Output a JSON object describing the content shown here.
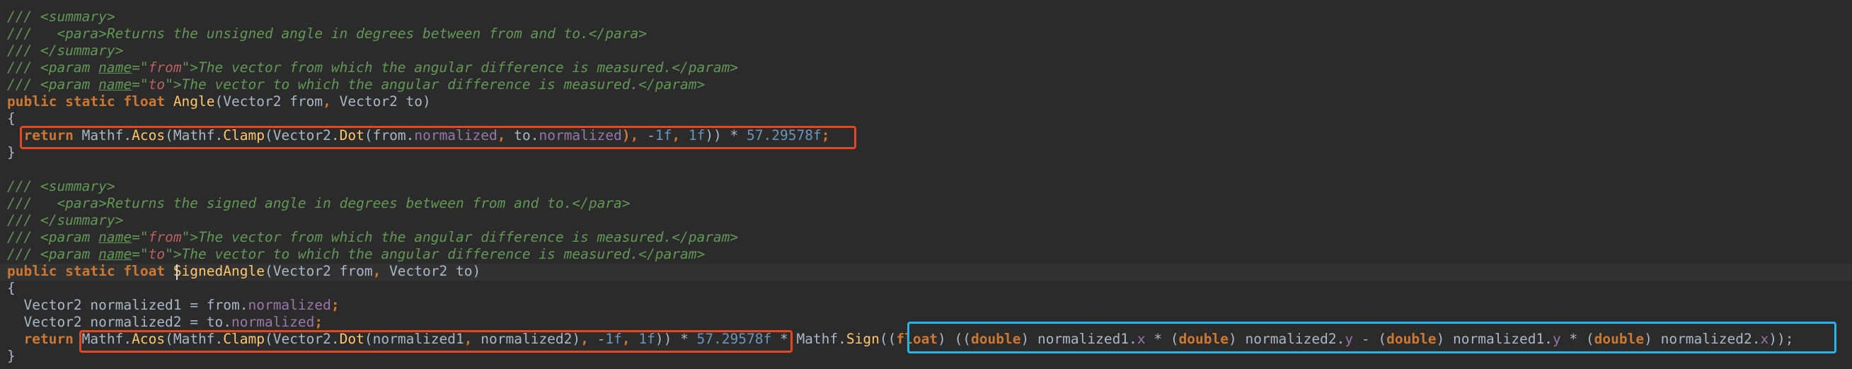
{
  "code": {
    "lines": [
      [
        {
          "t": "/// <summary>",
          "c": "c"
        }
      ],
      [
        {
          "t": "///   <para>",
          "c": "c"
        },
        {
          "t": "Returns the unsigned angle in degrees between from and to.",
          "c": "c"
        },
        {
          "t": "</para>",
          "c": "c"
        }
      ],
      [
        {
          "t": "/// </summary>",
          "c": "c"
        }
      ],
      [
        {
          "t": "/// <param ",
          "c": "c"
        },
        {
          "t": "name",
          "c": "cn"
        },
        {
          "t": "=\"",
          "c": "c"
        },
        {
          "t": "from",
          "c": "cv"
        },
        {
          "t": "\">The vector from which the angular difference is measured.</param>",
          "c": "c"
        }
      ],
      [
        {
          "t": "/// <param ",
          "c": "c"
        },
        {
          "t": "name",
          "c": "cn"
        },
        {
          "t": "=\"",
          "c": "c"
        },
        {
          "t": "to",
          "c": "cv"
        },
        {
          "t": "\">The vector to which the angular difference is measured.</param>",
          "c": "c"
        }
      ],
      [
        {
          "t": "public static float ",
          "c": "kw"
        },
        {
          "t": "Angle",
          "c": "fn"
        },
        {
          "t": "(Vector2 from",
          "c": "id"
        },
        {
          "t": ", ",
          "c": "kw"
        },
        {
          "t": "Vector2 to)",
          "c": "id"
        }
      ],
      [
        {
          "t": "{",
          "c": "id"
        }
      ],
      [
        {
          "t": "  ",
          "c": "id"
        },
        {
          "t": "return ",
          "c": "kw"
        },
        {
          "t": "Mathf.",
          "c": "id"
        },
        {
          "t": "Acos",
          "c": "fn"
        },
        {
          "t": "(Mathf.",
          "c": "id"
        },
        {
          "t": "Clamp",
          "c": "fn"
        },
        {
          "t": "(Vector2.",
          "c": "id"
        },
        {
          "t": "Dot",
          "c": "fn"
        },
        {
          "t": "(from.",
          "c": "id"
        },
        {
          "t": "normalized",
          "c": "pr"
        },
        {
          "t": ", ",
          "c": "kw"
        },
        {
          "t": "to.",
          "c": "id"
        },
        {
          "t": "normalized",
          "c": "pr"
        },
        {
          "t": "), ",
          "c": "kw"
        },
        {
          "t": "-",
          "c": "id"
        },
        {
          "t": "1f",
          "c": "num"
        },
        {
          "t": ", ",
          "c": "kw"
        },
        {
          "t": "1f",
          "c": "num"
        },
        {
          "t": ")) * ",
          "c": "id"
        },
        {
          "t": "57.29578f",
          "c": "num"
        },
        {
          "t": ";",
          "c": "kw"
        }
      ],
      [
        {
          "t": "}",
          "c": "id"
        }
      ],
      [],
      [
        {
          "t": "/// <summary>",
          "c": "c"
        }
      ],
      [
        {
          "t": "///   <para>",
          "c": "c"
        },
        {
          "t": "Returns the signed angle in degrees between from and to.",
          "c": "c"
        },
        {
          "t": "</para>",
          "c": "c"
        }
      ],
      [
        {
          "t": "/// </summary>",
          "c": "c"
        }
      ],
      [
        {
          "t": "/// <param ",
          "c": "c"
        },
        {
          "t": "name",
          "c": "cn"
        },
        {
          "t": "=\"",
          "c": "c"
        },
        {
          "t": "from",
          "c": "cv"
        },
        {
          "t": "\">The vector from which the angular difference is measured.</param>",
          "c": "c"
        }
      ],
      [
        {
          "t": "/// <param ",
          "c": "c"
        },
        {
          "t": "name",
          "c": "cn"
        },
        {
          "t": "=\"",
          "c": "c"
        },
        {
          "t": "to",
          "c": "cv"
        },
        {
          "t": "\">The vector to which the angular difference is measured.</param>",
          "c": "c"
        }
      ],
      [
        {
          "t": "public static float ",
          "c": "kw"
        },
        {
          "t": "SignedAngle",
          "c": "fn"
        },
        {
          "t": "(Vector2 from",
          "c": "id"
        },
        {
          "t": ", ",
          "c": "kw"
        },
        {
          "t": "Vector2 to)",
          "c": "id"
        }
      ],
      [
        {
          "t": "{",
          "c": "id"
        }
      ],
      [
        {
          "t": "  Vector2 normalized1 = from.",
          "c": "id"
        },
        {
          "t": "normalized",
          "c": "pr"
        },
        {
          "t": ";",
          "c": "kw"
        }
      ],
      [
        {
          "t": "  Vector2 normalized2 = to.",
          "c": "id"
        },
        {
          "t": "normalized",
          "c": "pr"
        },
        {
          "t": ";",
          "c": "kw"
        }
      ],
      [
        {
          "t": "  ",
          "c": "id"
        },
        {
          "t": "return ",
          "c": "kw"
        },
        {
          "t": "Mathf.",
          "c": "id"
        },
        {
          "t": "Acos",
          "c": "fn"
        },
        {
          "t": "(Mathf.",
          "c": "id"
        },
        {
          "t": "Clamp",
          "c": "fn"
        },
        {
          "t": "(Vector2.",
          "c": "id"
        },
        {
          "t": "Dot",
          "c": "fn"
        },
        {
          "t": "(normalized1",
          "c": "id"
        },
        {
          "t": ", ",
          "c": "kw"
        },
        {
          "t": "normalized2)",
          "c": "id"
        },
        {
          "t": ", ",
          "c": "kw"
        },
        {
          "t": "-",
          "c": "id"
        },
        {
          "t": "1f",
          "c": "num"
        },
        {
          "t": ", ",
          "c": "kw"
        },
        {
          "t": "1f",
          "c": "num"
        },
        {
          "t": ")) * ",
          "c": "id"
        },
        {
          "t": "57.29578f",
          "c": "num"
        },
        {
          "t": " * Mathf.",
          "c": "id"
        },
        {
          "t": "Sign",
          "c": "fn"
        },
        {
          "t": "((",
          "c": "id"
        },
        {
          "t": "float",
          "c": "kw"
        },
        {
          "t": ") ((",
          "c": "id"
        },
        {
          "t": "double",
          "c": "kw"
        },
        {
          "t": ") normalized1.",
          "c": "id"
        },
        {
          "t": "x",
          "c": "pr"
        },
        {
          "t": " * (",
          "c": "id"
        },
        {
          "t": "double",
          "c": "kw"
        },
        {
          "t": ") normalized2.",
          "c": "id"
        },
        {
          "t": "y",
          "c": "pr"
        },
        {
          "t": " - (",
          "c": "id"
        },
        {
          "t": "double",
          "c": "kw"
        },
        {
          "t": ") normalized1.",
          "c": "id"
        },
        {
          "t": "y",
          "c": "pr"
        },
        {
          "t": " * (",
          "c": "id"
        },
        {
          "t": "double",
          "c": "kw"
        },
        {
          "t": ") normalized2.",
          "c": "id"
        },
        {
          "t": "x",
          "c": "pr"
        },
        {
          "t": "));",
          "c": "id"
        }
      ],
      [
        {
          "t": "}",
          "c": "id"
        }
      ]
    ]
  },
  "colors": {
    "background": "#2b2b2b",
    "highlight_red": "#e8461e",
    "highlight_blue": "#27b4e8"
  }
}
